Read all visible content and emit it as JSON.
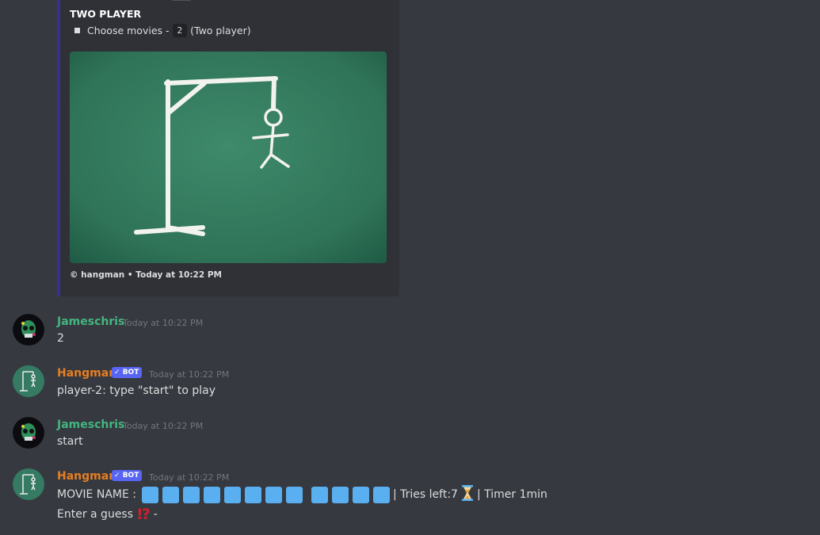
{
  "embed": {
    "title": "TWO PLAYER",
    "line_prefix": "Choose movies -",
    "line_code": "2",
    "line_suffix": "(Two player)",
    "footer": "© hangman • Today at 10:22 PM"
  },
  "messages": [
    {
      "author": "Jameschris",
      "timestamp": "Today at 10:22 PM",
      "text": "2"
    },
    {
      "author": "Hangman",
      "bot_tag": "BOT",
      "timestamp": "Today at 10:22 PM",
      "text": "player-2: type \"start\" to play"
    },
    {
      "author": "Jameschris",
      "timestamp": "Today at 10:22 PM",
      "text": "start"
    },
    {
      "author": "Hangman",
      "bot_tag": "BOT",
      "timestamp": "Today at 10:22 PM",
      "movie_label": "MOVIE NAME  :",
      "tries": "| Tries left:7",
      "timer": "| Timer 1min",
      "guess_prefix": "Enter a guess",
      "guess_suffix": "-"
    }
  ],
  "colors": {
    "user": "#43b581",
    "bot": "#e67e22",
    "blank_tile": "#5aaff0",
    "bot_tag": "#5865f2"
  }
}
